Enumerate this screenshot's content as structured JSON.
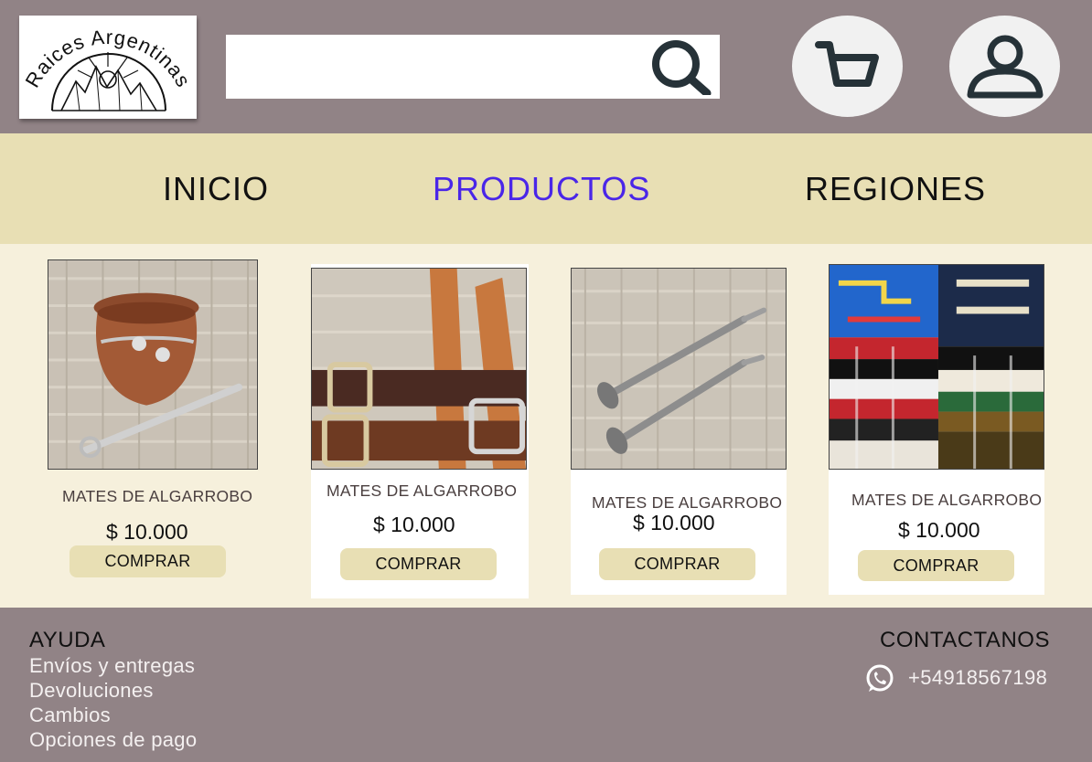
{
  "brand": {
    "logo_text": "Raices Argentinas"
  },
  "search": {
    "placeholder": "",
    "value": ""
  },
  "nav": {
    "items": [
      {
        "label": "INICIO",
        "active": false
      },
      {
        "label": "PRODUCTOS",
        "active": true
      },
      {
        "label": "REGIONES",
        "active": false
      }
    ]
  },
  "products": [
    {
      "title": "MATES DE ALGARROBO",
      "price": "$ 10.000",
      "button": "COMPRAR"
    },
    {
      "title": "MATES DE ALGARROBO",
      "price": "$ 10.000",
      "button": "COMPRAR"
    },
    {
      "title": "MATES DE ALGARROBO",
      "price": "$ 10.000",
      "button": "COMPRAR"
    },
    {
      "title": "MATES DE ALGARROBO",
      "price": "$ 10.000",
      "button": "COMPRAR"
    }
  ],
  "footer": {
    "help_title": "AYUDA",
    "help_links": [
      "Envíos y entregas",
      "Devoluciones",
      "Cambios",
      "Opciones de pago"
    ],
    "contact_title": "CONTACTANOS",
    "phone": "+54918567198"
  },
  "colors": {
    "header": "#918386",
    "nav": "#e8dfb4",
    "page": "#f6f0dc",
    "active_nav": "#4a26e8",
    "button": "#e8dfb4"
  },
  "icons": [
    "search-icon",
    "cart-icon",
    "user-icon",
    "whatsapp-icon"
  ]
}
